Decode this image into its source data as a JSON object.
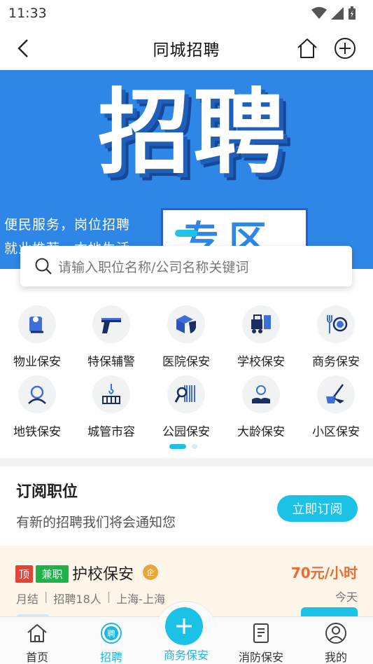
{
  "status_bar": {
    "time": "11:33"
  },
  "header": {
    "title": "同城招聘"
  },
  "banner": {
    "big_text": "招聘",
    "line1": "便民服务，岗位招聘",
    "line2": "就业推荐，本地生活",
    "zone_text": "专区"
  },
  "search": {
    "placeholder": "请输入职位名称/公司名称关键词"
  },
  "categories": [
    {
      "label": "物业保安",
      "icon": "security-guard-icon"
    },
    {
      "label": "特保辅警",
      "icon": "pistol-icon"
    },
    {
      "label": "医院保安",
      "icon": "medical-shield-icon"
    },
    {
      "label": "学校保安",
      "icon": "forklift-icon"
    },
    {
      "label": "商务保安",
      "icon": "fork-plate-icon"
    },
    {
      "label": "地铁保安",
      "icon": "headset-person-icon"
    },
    {
      "label": "城管市容",
      "icon": "crane-hook-icon"
    },
    {
      "label": "公园保安",
      "icon": "barcode-search-icon"
    },
    {
      "label": "大龄保安",
      "icon": "award-hand-icon"
    },
    {
      "label": "小区保安",
      "icon": "cleaning-bucket-icon"
    }
  ],
  "subscribe": {
    "title": "订阅职位",
    "desc": "有新的招聘我们将会通知您",
    "button": "立即订阅"
  },
  "job": {
    "tag_top": "顶",
    "tag_part": "兼职",
    "title": "护校保安",
    "badge": "企",
    "pay": "70元/小时",
    "settle": "月结",
    "hiring": "招聘18人",
    "location": "上海-上海",
    "time": "今天"
  },
  "nav": {
    "home": "首页",
    "jobs": "招聘",
    "center": "商务保安",
    "fire": "消防保安",
    "mine": "我的",
    "jobs_icon_text": "聘"
  },
  "colors": {
    "accent": "#1cc1e6",
    "banner": "#2e86e6",
    "pay": "#ef6a31"
  }
}
